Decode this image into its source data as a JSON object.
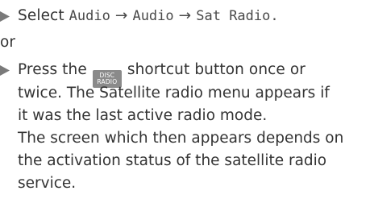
{
  "step1": {
    "prefix": "Select",
    "menu_path": [
      "Audio",
      "Audio",
      "Sat Radio."
    ]
  },
  "or_text": "or",
  "step2": {
    "before_button": "Press the",
    "button_label_top": "DISC",
    "button_label_bottom": "RADIO",
    "after_button": "shortcut button once or",
    "lines": [
      "twice. The Satellite radio menu appears if",
      "it was the last active radio mode.",
      "The screen which then appears depends on",
      "the activation status of the satellite radio",
      "service."
    ]
  },
  "colors": {
    "text": "#333333",
    "bullet": "#7a7a7a",
    "button_bg": "#8a8a8a"
  },
  "icons": {
    "bullet": "triangle-right-icon",
    "arrow": "right-arrow-icon"
  }
}
